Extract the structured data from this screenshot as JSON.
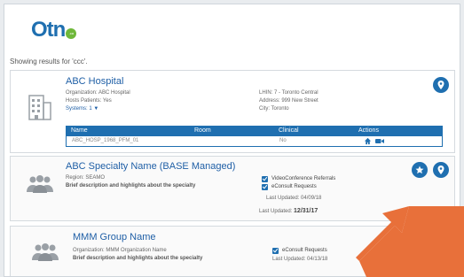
{
  "logo": {
    "text": "Otn",
    "sub": ".ca"
  },
  "results": {
    "text": "Showing results for 'ccc'."
  },
  "card1": {
    "title": "ABC Hospital",
    "organization": "Organization: ABC Hospital",
    "hosts_patients": "Hosts Patients: Yes",
    "systems": "Systems: 1 ▼",
    "lhin": "LHIN: 7 - Toronto Central",
    "address": "Address: 999 New Street",
    "city": "City: Toronto",
    "table": {
      "headers": [
        "Name",
        "Room",
        "Clinical",
        "Actions"
      ],
      "row": {
        "name": "ABC_HOSP_1968_PFM_01",
        "room": "",
        "clinical": "No"
      }
    }
  },
  "card2": {
    "title": "ABC Specialty Name (BASE Managed)",
    "region": "Region: SEAMO",
    "desc": "Brief description and highlights about the specialty",
    "check1": "VideoConference Referrals",
    "check2": "eConsult Requests",
    "updated1": "Last Updated: 04/09/18",
    "updated2_label": "Last Updated:",
    "updated2_value": "12/31/17"
  },
  "card3": {
    "title": "MMM Group Name",
    "organization": "Organization: MMM Organization Name",
    "desc": "Brief description and highlights about the specialty",
    "check1": "eConsult Requests",
    "updated": "Last Updated: 04/13/18"
  },
  "colors": {
    "brand_blue": "#1f6fb0",
    "accent_green": "#6fb83a",
    "arrow_orange": "#e8703a"
  }
}
